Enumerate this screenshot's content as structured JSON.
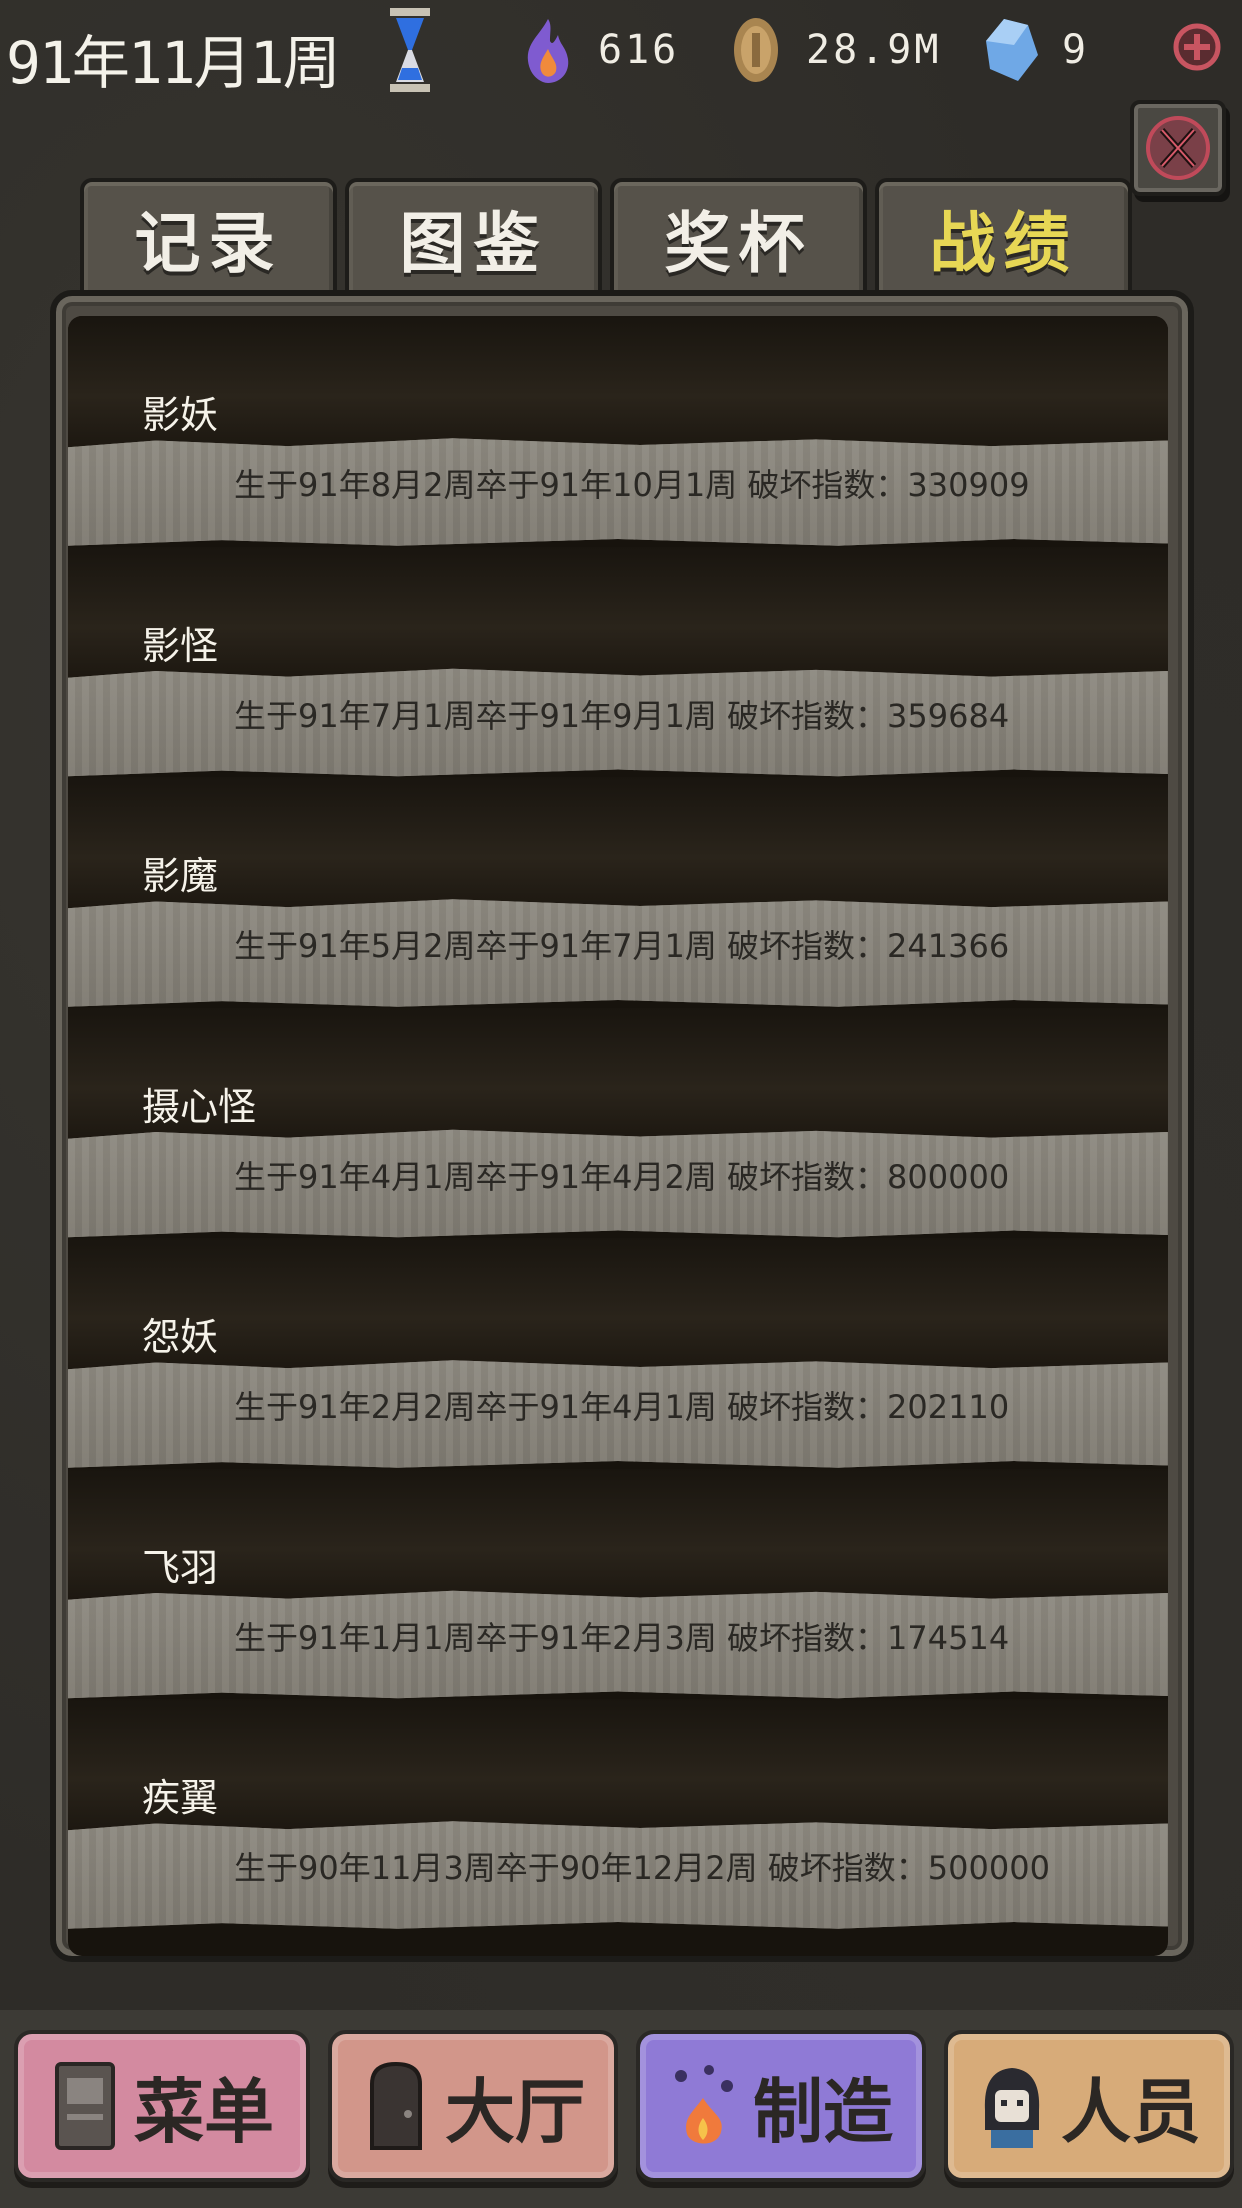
{
  "topbar": {
    "date": "91年11月1周",
    "flame_value": "616",
    "coin_value": "28.9M",
    "gem_value": "9"
  },
  "tabs": [
    {
      "label": "记录",
      "active": false
    },
    {
      "label": "图鉴",
      "active": false
    },
    {
      "label": "奖杯",
      "active": false
    },
    {
      "label": "战绩",
      "active": true
    }
  ],
  "records": [
    {
      "name": "影妖",
      "info": "生于91年8月2周卒于91年10月1周  破坏指数：330909"
    },
    {
      "name": "影怪",
      "info": "生于91年7月1周卒于91年9月1周  破坏指数：359684"
    },
    {
      "name": "影魔",
      "info": "生于91年5月2周卒于91年7月1周  破坏指数：241366"
    },
    {
      "name": "摄心怪",
      "info": "生于91年4月1周卒于91年4月2周  破坏指数：800000"
    },
    {
      "name": "怨妖",
      "info": "生于91年2月2周卒于91年4月1周  破坏指数：202110"
    },
    {
      "name": "飞羽",
      "info": "生于91年1月1周卒于91年2月3周  破坏指数：174514"
    },
    {
      "name": "疾翼",
      "info": "生于90年11月3周卒于90年12月2周  破坏指数：500000"
    }
  ],
  "bottom_nav": {
    "menu": "菜单",
    "hall": "大厅",
    "craft": "制造",
    "crew": "人员"
  },
  "colors": {
    "active_tab": "#e7d755",
    "menu": "#d38aa0",
    "hall": "#d2968a",
    "craft": "#8f7ad6",
    "crew": "#d7ab79"
  }
}
